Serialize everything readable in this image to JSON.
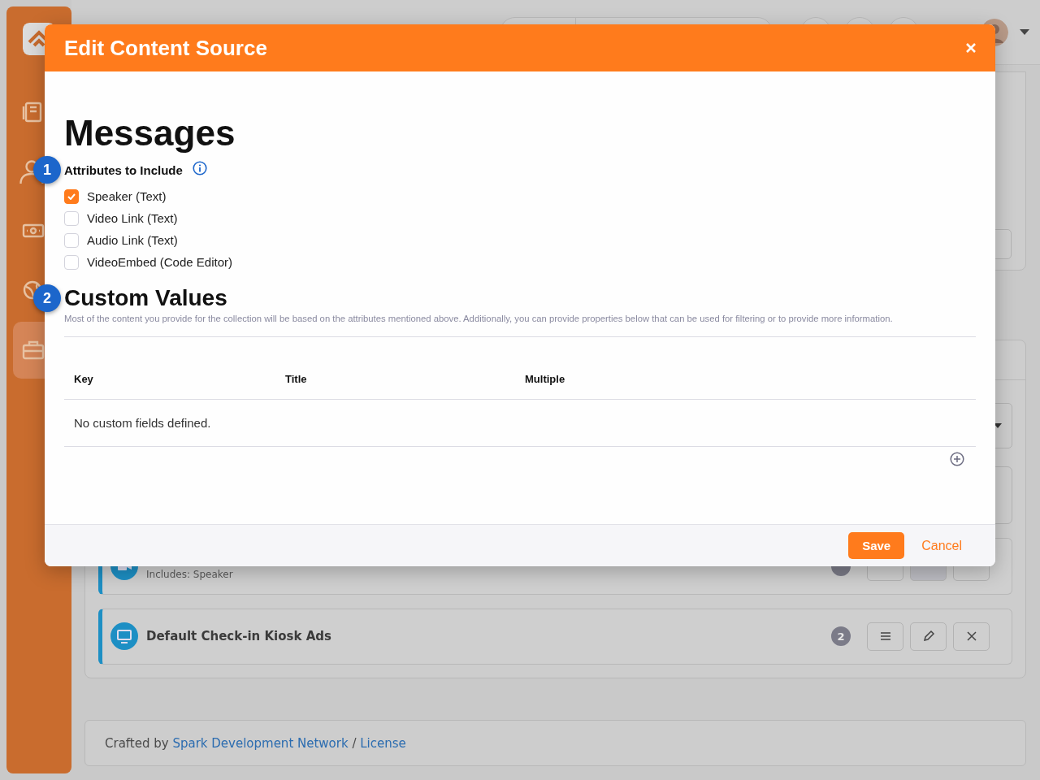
{
  "sidebar": {
    "items": [
      {
        "selected": false
      },
      {
        "selected": false
      },
      {
        "selected": false
      },
      {
        "selected": false
      },
      {
        "selected": true
      }
    ]
  },
  "sources": [
    {
      "subtitle": "Includes: Speaker"
    },
    {
      "title": "Default Check-in Kiosk Ads",
      "count": "2"
    }
  ],
  "footer": {
    "prefix": "Crafted by",
    "link": "Spark Development Network",
    "separator": "/",
    "license": "License"
  },
  "modal": {
    "title": "Edit Content Source",
    "heading": "Messages",
    "attributes_label": "Attributes to Include",
    "attributes_callout": "1",
    "attributes": [
      {
        "label": "Speaker (Text)",
        "checked": true
      },
      {
        "label": "Video Link (Text)",
        "checked": false
      },
      {
        "label": "Audio Link (Text)",
        "checked": false
      },
      {
        "label": "VideoEmbed (Code Editor)",
        "checked": false
      }
    ],
    "custom_values": {
      "heading": "Custom Values",
      "callout": "2",
      "description": "Most of the content you provide for the collection will be based on the attributes mentioned above. Additionally, you can provide properties below that can be used for filtering or to provide more information.",
      "table": {
        "columns": [
          "Key",
          "Title",
          "Multiple"
        ],
        "empty_message": "No custom fields defined."
      }
    },
    "buttons": [
      {
        "label": "Save",
        "kind": "primary"
      },
      {
        "label": "Cancel",
        "kind": "link"
      }
    ]
  }
}
